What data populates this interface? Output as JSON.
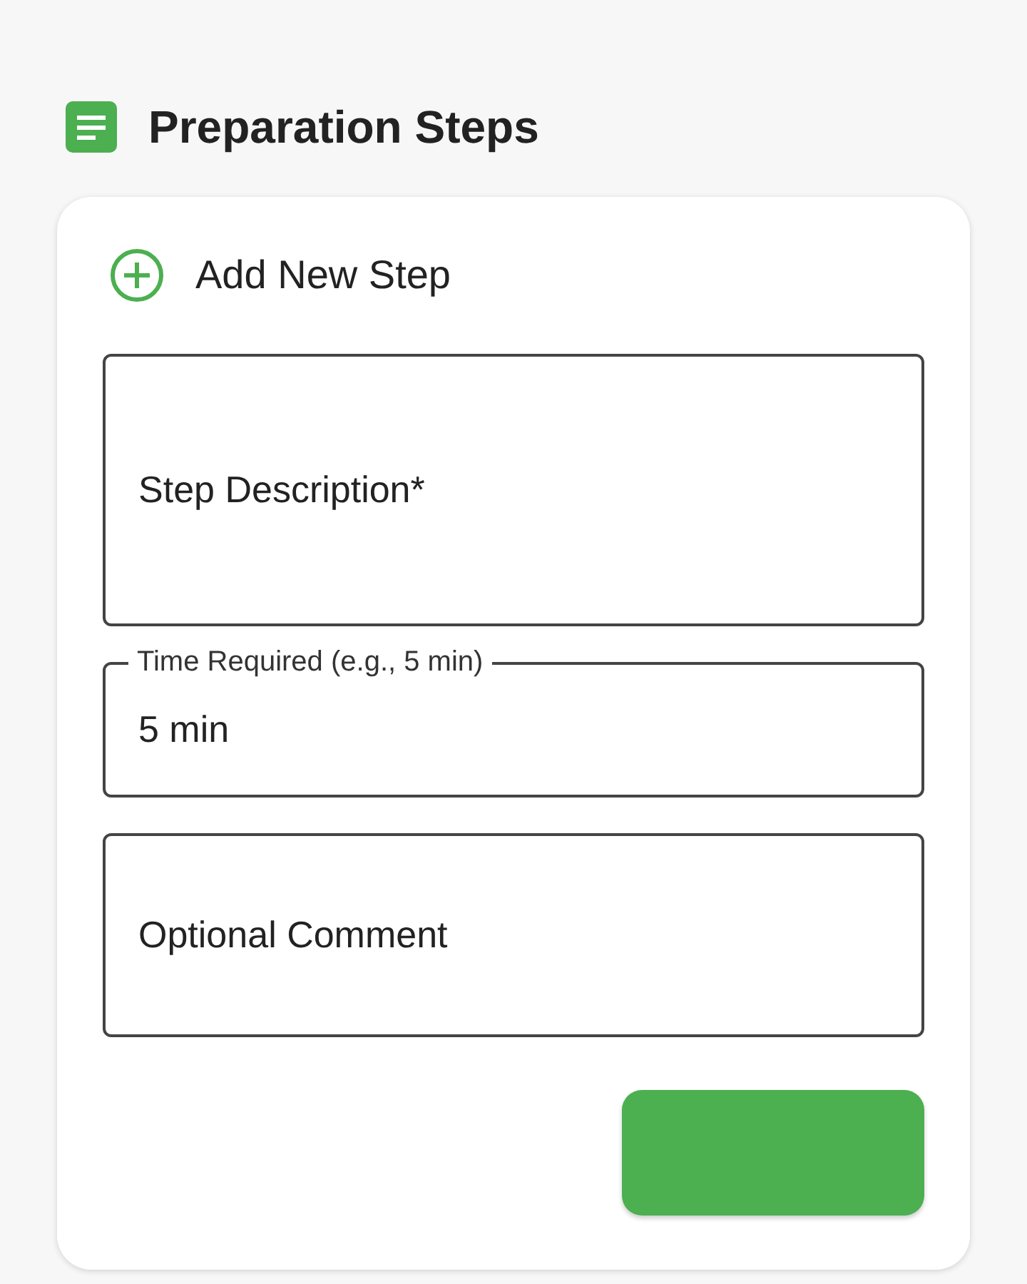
{
  "section": {
    "title": "Preparation Steps"
  },
  "form": {
    "title": "Add New Step",
    "fields": [
      {
        "kind": "tall",
        "placeholder": "Step Description*"
      },
      {
        "kind": "short",
        "label": "Time Required (e.g., 5 min)",
        "value": "5 min"
      },
      {
        "kind": "medium",
        "placeholder": "Optional Comment"
      }
    ]
  }
}
